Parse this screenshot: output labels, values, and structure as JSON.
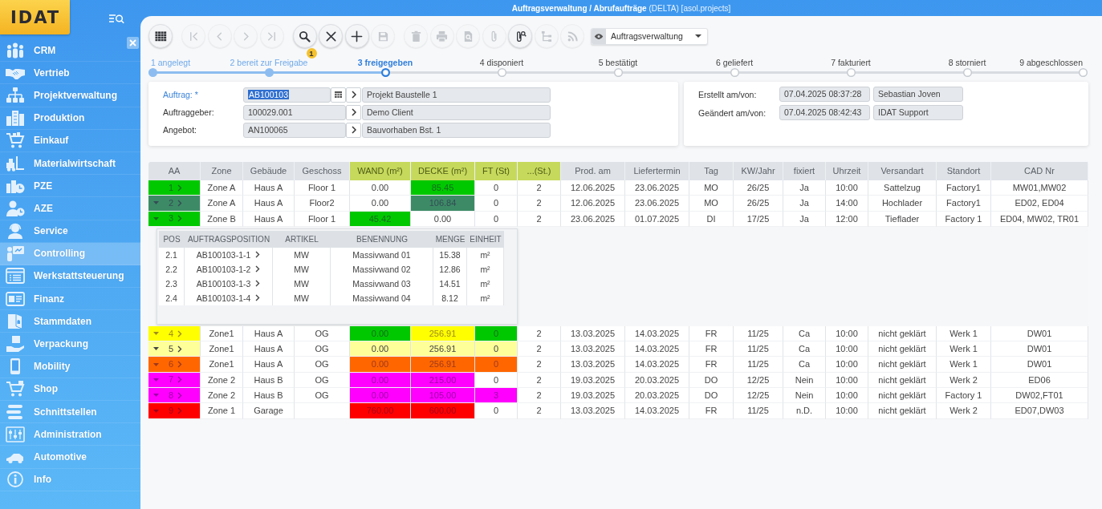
{
  "window": {
    "title": "**Auftragsverwaltung / Abrufaufträge** (DELTA) [asol.projects]"
  },
  "sidebar": {
    "logo": "IDAT",
    "items": [
      {
        "label": "CRM",
        "selected": false
      },
      {
        "label": "Vertrieb",
        "selected": false
      },
      {
        "label": "Projektverwaltung",
        "selected": false
      },
      {
        "label": "Produktion",
        "selected": false
      },
      {
        "label": "Einkauf",
        "selected": false
      },
      {
        "label": "Materialwirtschaft",
        "selected": false
      },
      {
        "label": "PZE",
        "selected": false
      },
      {
        "label": "AZE",
        "selected": false
      },
      {
        "label": "Service",
        "selected": false
      },
      {
        "label": "Controlling",
        "selected": true
      },
      {
        "label": "Werkstattsteuerung",
        "selected": false
      },
      {
        "label": "Finanz",
        "selected": false
      },
      {
        "label": "Stammdaten",
        "selected": false
      },
      {
        "label": "Verpackung",
        "selected": false
      },
      {
        "label": "Mobility",
        "selected": false
      },
      {
        "label": "Shop",
        "selected": false
      },
      {
        "label": "Schnittstellen",
        "selected": false
      },
      {
        "label": "Administration",
        "selected": false
      },
      {
        "label": "Automotive",
        "selected": false
      },
      {
        "label": "Info",
        "selected": false
      }
    ]
  },
  "toolbar": {
    "groups": [
      {
        "buttons": [
          {
            "disabled": false
          }
        ]
      },
      {
        "buttons": [
          {
            "disabled": true
          },
          {
            "disabled": true
          },
          {
            "disabled": true
          },
          {
            "disabled": true
          }
        ]
      },
      {
        "buttons": [
          {
            "disabled": false,
            "badge": "1"
          },
          {
            "disabled": false
          },
          {
            "disabled": false
          },
          {
            "disabled": true
          }
        ]
      },
      {
        "buttons": [
          {
            "disabled": true
          },
          {
            "disabled": true
          },
          {
            "disabled": true
          },
          {
            "disabled": true
          },
          {
            "disabled": false
          },
          {
            "disabled": true
          },
          {
            "disabled": true
          }
        ]
      }
    ],
    "view_select": {
      "value": "Auftragsverwaltung"
    }
  },
  "steps": [
    {
      "label": "1 angelegt",
      "done": true,
      "selected": false
    },
    {
      "label": "2 bereit zur Freigabe",
      "done": true,
      "selected": false
    },
    {
      "label": "3 freigegeben",
      "done": false,
      "selected": true
    },
    {
      "label": "4 disponiert",
      "done": false,
      "selected": false
    },
    {
      "label": "5 bestätigt",
      "done": false,
      "selected": false
    },
    {
      "label": "6 geliefert",
      "done": false,
      "selected": false
    },
    {
      "label": "7 fakturiert",
      "done": false,
      "selected": false
    },
    {
      "label": "8 storniert",
      "done": false,
      "selected": false
    },
    {
      "label": "9 abgeschlossen",
      "done": false,
      "selected": false
    }
  ],
  "order": {
    "fields": [
      {
        "label": "Auftrag: *",
        "required": true,
        "code": "AB100103",
        "code_selected": true,
        "picker": true,
        "description": "Projekt Baustelle 1"
      },
      {
        "label": "Auftraggeber:",
        "required": false,
        "code": "100029.001",
        "code_selected": false,
        "picker": false,
        "description": "Demo Client"
      },
      {
        "label": "Angebot:",
        "required": false,
        "code": "AN100065",
        "code_selected": false,
        "picker": false,
        "description": "Bauvorhaben Bst. 1"
      }
    ]
  },
  "audit": {
    "rows": [
      {
        "label": "Erstellt am/von:",
        "date": "07.04.2025 08:37:28",
        "user": "Sebastian Joven"
      },
      {
        "label": "Geändert am/von:",
        "date": "07.04.2025 08:42:43",
        "user": "IDAT Support"
      }
    ]
  },
  "table": {
    "columns": [
      {
        "label": "AA",
        "highlighted": false
      },
      {
        "label": "Zone",
        "highlighted": false
      },
      {
        "label": "Gebäude",
        "highlighted": false
      },
      {
        "label": "Geschoss",
        "highlighted": false
      },
      {
        "label": "WAND (m²)",
        "highlighted": true
      },
      {
        "label": "DECKE (m²)",
        "highlighted": true
      },
      {
        "label": "FT (St)",
        "highlighted": true
      },
      {
        "label": "...(St.)",
        "highlighted": true
      },
      {
        "label": "Prod. am",
        "highlighted": false
      },
      {
        "label": "Liefertermin",
        "highlighted": false
      },
      {
        "label": "Tag",
        "highlighted": false
      },
      {
        "label": "KW/Jahr",
        "highlighted": false
      },
      {
        "label": "fixiert",
        "highlighted": false
      },
      {
        "label": "Uhrzeit",
        "highlighted": false
      },
      {
        "label": "Versandart",
        "highlighted": false
      },
      {
        "label": "Standort",
        "highlighted": false
      },
      {
        "label": "CAD Nr",
        "highlighted": false
      }
    ],
    "rows": [
      {
        "expandable": false,
        "cells": [
          {
            "text": "1",
            "color": "#00c800"
          },
          {
            "text": "Zone A"
          },
          {
            "text": "Haus A"
          },
          {
            "text": "Floor 1"
          },
          {
            "text": "0.00"
          },
          {
            "text": "85.45",
            "color": "#00c800"
          },
          {
            "text": "0"
          },
          {
            "text": "2"
          },
          {
            "text": "12.06.2025"
          },
          {
            "text": "23.06.2025"
          },
          {
            "text": "MO"
          },
          {
            "text": "26/25"
          },
          {
            "text": "Ja"
          },
          {
            "text": "10:00"
          },
          {
            "text": "Sattelzug"
          },
          {
            "text": "Factory1"
          },
          {
            "text": "MW01,MW02"
          }
        ]
      },
      {
        "expandable": true,
        "cells": [
          {
            "text": "2",
            "color": "#3d8b66"
          },
          {
            "text": "Zone A"
          },
          {
            "text": "Haus A"
          },
          {
            "text": "Floor2"
          },
          {
            "text": "0.00"
          },
          {
            "text": "106.84",
            "color": "#3d8b66"
          },
          {
            "text": "0"
          },
          {
            "text": "2"
          },
          {
            "text": "12.06.2025"
          },
          {
            "text": "23.06.2025"
          },
          {
            "text": "MO"
          },
          {
            "text": "26/25"
          },
          {
            "text": "Ja"
          },
          {
            "text": "14:00"
          },
          {
            "text": "Hochlader"
          },
          {
            "text": "Factory1"
          },
          {
            "text": "ED02, ED04"
          }
        ]
      },
      {
        "expandable": true,
        "cells": [
          {
            "text": "3",
            "color": "#00c800"
          },
          {
            "text": "Zone B"
          },
          {
            "text": "Haus A"
          },
          {
            "text": "Floor 1"
          },
          {
            "text": "45.42",
            "color": "#00c800"
          },
          {
            "text": "0.00"
          },
          {
            "text": "0"
          },
          {
            "text": "2"
          },
          {
            "text": "23.06.2025"
          },
          {
            "text": "01.07.2025"
          },
          {
            "text": "DI"
          },
          {
            "text": "17/25"
          },
          {
            "text": "Ja"
          },
          {
            "text": "12:00"
          },
          {
            "text": "Tieflader"
          },
          {
            "text": "Factory 1"
          },
          {
            "text": "ED04, MW02, TR01"
          }
        ],
        "details": {
          "columns": [
            "POS",
            "AUFTRAGSPOSITION",
            "ARTIKEL",
            "BENENNUNG",
            "MENGE",
            "EINHEIT"
          ],
          "rows": [
            {
              "cells": [
                "2.1",
                "AB100103-1-1",
                "MW",
                "Massivwand 01",
                "15.38",
                "m²"
              ]
            },
            {
              "cells": [
                "2.2",
                "AB100103-1-2",
                "MW",
                "Massivwand 02",
                "12.86",
                "m²"
              ]
            },
            {
              "cells": [
                "2.3",
                "AB100103-1-3",
                "MW",
                "Massivwand 03",
                "14.51",
                "m²"
              ]
            },
            {
              "cells": [
                "2.4",
                "AB100103-1-4",
                "MW",
                "Massivwand 04",
                "8.12",
                "m²"
              ]
            }
          ]
        }
      },
      {
        "expandable": true,
        "cells": [
          {
            "text": "4",
            "color": "#ffff00"
          },
          {
            "text": "Zone1"
          },
          {
            "text": "Haus A"
          },
          {
            "text": "OG"
          },
          {
            "text": "0.00",
            "color": "#00c800"
          },
          {
            "text": "256.91",
            "color": "#ffff00"
          },
          {
            "text": "0",
            "color": "#00c800"
          },
          {
            "text": "2"
          },
          {
            "text": "13.03.2025"
          },
          {
            "text": "14.03.2025"
          },
          {
            "text": "FR"
          },
          {
            "text": "11/25"
          },
          {
            "text": "Ca"
          },
          {
            "text": "10:00"
          },
          {
            "text": "nicht geklärt"
          },
          {
            "text": "Werk 1"
          },
          {
            "text": "DW01"
          }
        ]
      },
      {
        "expandable": true,
        "cells": [
          {
            "text": "5",
            "color": "#ffff99"
          },
          {
            "text": "Zone1"
          },
          {
            "text": "Haus A"
          },
          {
            "text": "OG"
          },
          {
            "text": "0.00",
            "color": "#ffff99"
          },
          {
            "text": "256.91",
            "color": "#ffff99"
          },
          {
            "text": "0",
            "color": "#ffff99"
          },
          {
            "text": "2"
          },
          {
            "text": "13.03.2025"
          },
          {
            "text": "14.03.2025"
          },
          {
            "text": "FR"
          },
          {
            "text": "11/25"
          },
          {
            "text": "Ca"
          },
          {
            "text": "10:00"
          },
          {
            "text": "nicht geklärt"
          },
          {
            "text": "Werk 1"
          },
          {
            "text": "DW01"
          }
        ]
      },
      {
        "expandable": true,
        "cells": [
          {
            "text": "6",
            "color": "#ff6600"
          },
          {
            "text": "Zone1"
          },
          {
            "text": "Haus A"
          },
          {
            "text": "OG"
          },
          {
            "text": "0.00",
            "color": "#ff6600"
          },
          {
            "text": "256.91",
            "color": "#ff6600"
          },
          {
            "text": "0",
            "color": "#ff6600"
          },
          {
            "text": "2"
          },
          {
            "text": "13.03.2025"
          },
          {
            "text": "14.03.2025"
          },
          {
            "text": "FR"
          },
          {
            "text": "11/25"
          },
          {
            "text": "Ca"
          },
          {
            "text": "10:00"
          },
          {
            "text": "nicht geklärt"
          },
          {
            "text": "Werk 1"
          },
          {
            "text": "DW01"
          }
        ]
      },
      {
        "expandable": true,
        "cells": [
          {
            "text": "7",
            "color": "#ff00ff"
          },
          {
            "text": "Zone 2"
          },
          {
            "text": "Haus B"
          },
          {
            "text": "OG"
          },
          {
            "text": "0.00",
            "color": "#ff00ff"
          },
          {
            "text": "215.00",
            "color": "#ff00ff"
          },
          {
            "text": "0"
          },
          {
            "text": "2"
          },
          {
            "text": "19.03.2025"
          },
          {
            "text": "20.03.2025"
          },
          {
            "text": "DO"
          },
          {
            "text": "12/25"
          },
          {
            "text": "Nein"
          },
          {
            "text": "10:00"
          },
          {
            "text": "nicht geklärt"
          },
          {
            "text": "Werk 2"
          },
          {
            "text": "ED06"
          }
        ]
      },
      {
        "expandable": true,
        "cells": [
          {
            "text": "8",
            "color": "#ff00ff"
          },
          {
            "text": "Zone 2"
          },
          {
            "text": "Haus B"
          },
          {
            "text": "OG"
          },
          {
            "text": "0.00",
            "color": "#ff00ff"
          },
          {
            "text": "105.00",
            "color": "#ff00ff"
          },
          {
            "text": "3",
            "color": "#ff00ff"
          },
          {
            "text": "2"
          },
          {
            "text": "19.03.2025"
          },
          {
            "text": "20.03.2025"
          },
          {
            "text": "DO"
          },
          {
            "text": "12/25"
          },
          {
            "text": "Nein"
          },
          {
            "text": "10:00"
          },
          {
            "text": "nicht geklärt"
          },
          {
            "text": "Factory 1"
          },
          {
            "text": "DW02,FT01"
          }
        ]
      },
      {
        "expandable": true,
        "cells": [
          {
            "text": "9",
            "color": "#ff0000"
          },
          {
            "text": "Zone 1"
          },
          {
            "text": "Garage"
          },
          {},
          {
            "text": "760.00",
            "color": "#ff0000"
          },
          {
            "text": "600.00",
            "color": "#ff0000"
          },
          {
            "text": "0"
          },
          {
            "text": "2"
          },
          {
            "text": "13.03.2025"
          },
          {
            "text": "14.03.2025"
          },
          {
            "text": "FR"
          },
          {
            "text": "11/25"
          },
          {
            "text": "n.D."
          },
          {
            "text": "10:00"
          },
          {
            "text": "nicht geklärt"
          },
          {
            "text": "Werk 2"
          },
          {
            "text": "ED07,DW03"
          }
        ]
      }
    ]
  }
}
